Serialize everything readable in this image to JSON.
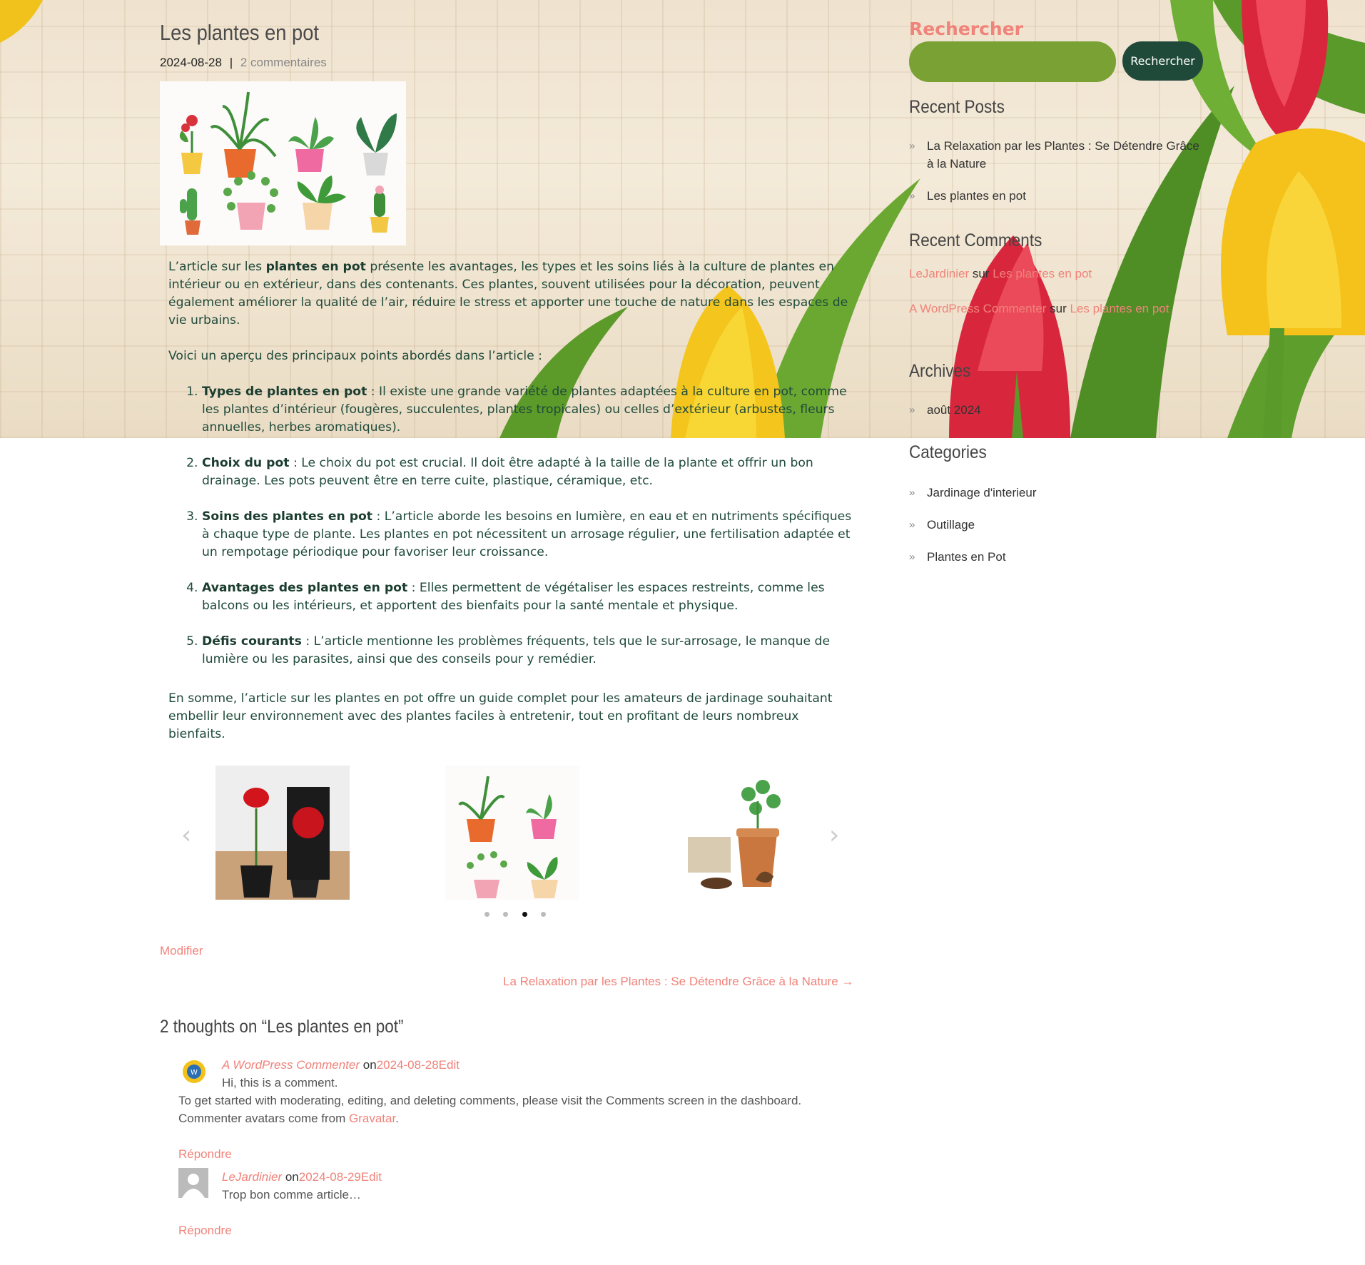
{
  "post": {
    "title": "Les plantes en pot",
    "date": "2024-08-28",
    "separator": "|",
    "comments_link": "2 commentaires"
  },
  "article": {
    "intro_a": "L’article sur les ",
    "intro_bold": "plantes en pot",
    "intro_b": " présente les avantages, les types et les soins liés à la culture de plantes en intérieur ou en extérieur, dans des contenants. Ces plantes, souvent utilisées pour la décoration, peuvent également améliorer la qualité de l’air, réduire le stress et apporter une touche de nature dans les espaces de vie urbains.",
    "overview": "Voici un aperçu des principaux points abordés dans l’article :",
    "points": [
      {
        "title": "Types de plantes en pot",
        "text": " : Il existe une grande variété de plantes adaptées à la culture en pot, comme les plantes d’intérieur (fougères, succulentes, plantes tropicales) ou celles d’extérieur (arbustes, fleurs annuelles, herbes aromatiques)."
      },
      {
        "title": "Choix du pot",
        "text": " : Le choix du pot est crucial. Il doit être adapté à la taille de la plante et offrir un bon drainage. Les pots peuvent être en terre cuite, plastique, céramique, etc."
      },
      {
        "title": "Soins des plantes en pot",
        "text": " : L’article aborde les besoins en lumière, en eau et en nutriments spécifiques à chaque type de plante. Les plantes en pot nécessitent un arrosage régulier, une fertilisation adaptée et un rempotage périodique pour favoriser leur croissance."
      },
      {
        "title": "Avantages des plantes en pot",
        "text": " : Elles permettent de végétaliser les espaces restreints, comme les balcons ou les intérieurs, et apportent des bienfaits pour la santé mentale et physique."
      },
      {
        "title": "Défis courants",
        "text": " : L’article mentionne les problèmes fréquents, tels que le sur-arrosage, le manque de lumière ou les parasites, ainsi que des conseils pour y remédier."
      }
    ],
    "conclusion": "En somme, l’article sur les plantes en pot offre un guide complet pour les amateurs de jardinage souhaitant embellir leur environnement avec des plantes faciles à entretenir, tout en profitant de leurs nombreux bienfaits."
  },
  "carousel": {
    "prev_icon": "chevron-left-icon",
    "next_icon": "chevron-right-icon",
    "prev_glyph": "‹",
    "next_glyph": "›",
    "active_dot": 2,
    "dot_count": 4
  },
  "edit_label": "Modifier",
  "next_post": "La Relaxation par les Plantes : Se Détendre Grâce à la Nature →",
  "comments": {
    "title": "2 thoughts on “Les plantes en pot”",
    "items": [
      {
        "author": "A WordPress Commenter",
        "on": "on",
        "date": "2024-08-28",
        "edit": "Edit",
        "line1": "Hi, this is a comment.",
        "line2": "To get started with moderating, editing, and deleting comments, please visit the Comments screen in the dashboard.",
        "line3_a": "Commenter avatars come from ",
        "line3_link": "Gravatar",
        "line3_b": ".",
        "reply": "Répondre"
      },
      {
        "author": "LeJardinier",
        "on": "on",
        "date": "2024-08-29",
        "edit": "Edit",
        "line1": "Trop bon comme article…",
        "reply": "Répondre"
      }
    ]
  },
  "sidebar": {
    "search_title": "Rechercher",
    "search_placeholder": "",
    "search_button": "Rechercher",
    "recent_posts_title": "Recent Posts",
    "recent_posts": [
      "La Relaxation par les Plantes : Se Détendre Grâce à la Nature",
      "Les plantes en pot"
    ],
    "recent_comments_title": "Recent Comments",
    "recent_comments": [
      {
        "author": "LeJardinier",
        "sur": "sur",
        "post": "Les plantes en pot"
      },
      {
        "author": "A WordPress Commenter",
        "sur": "sur",
        "post": "Les plantes en pot"
      }
    ],
    "archives_title": "Archives",
    "archives": [
      "août 2024"
    ],
    "categories_title": "Categories",
    "categories": [
      "Jardinage d'interieur",
      "Outillage",
      "Plantes en Pot"
    ],
    "chevron_glyph": "»"
  },
  "colors": {
    "accent": "#f0837a",
    "search_field": "#7aa133",
    "dark_green": "#1f4a3a"
  }
}
